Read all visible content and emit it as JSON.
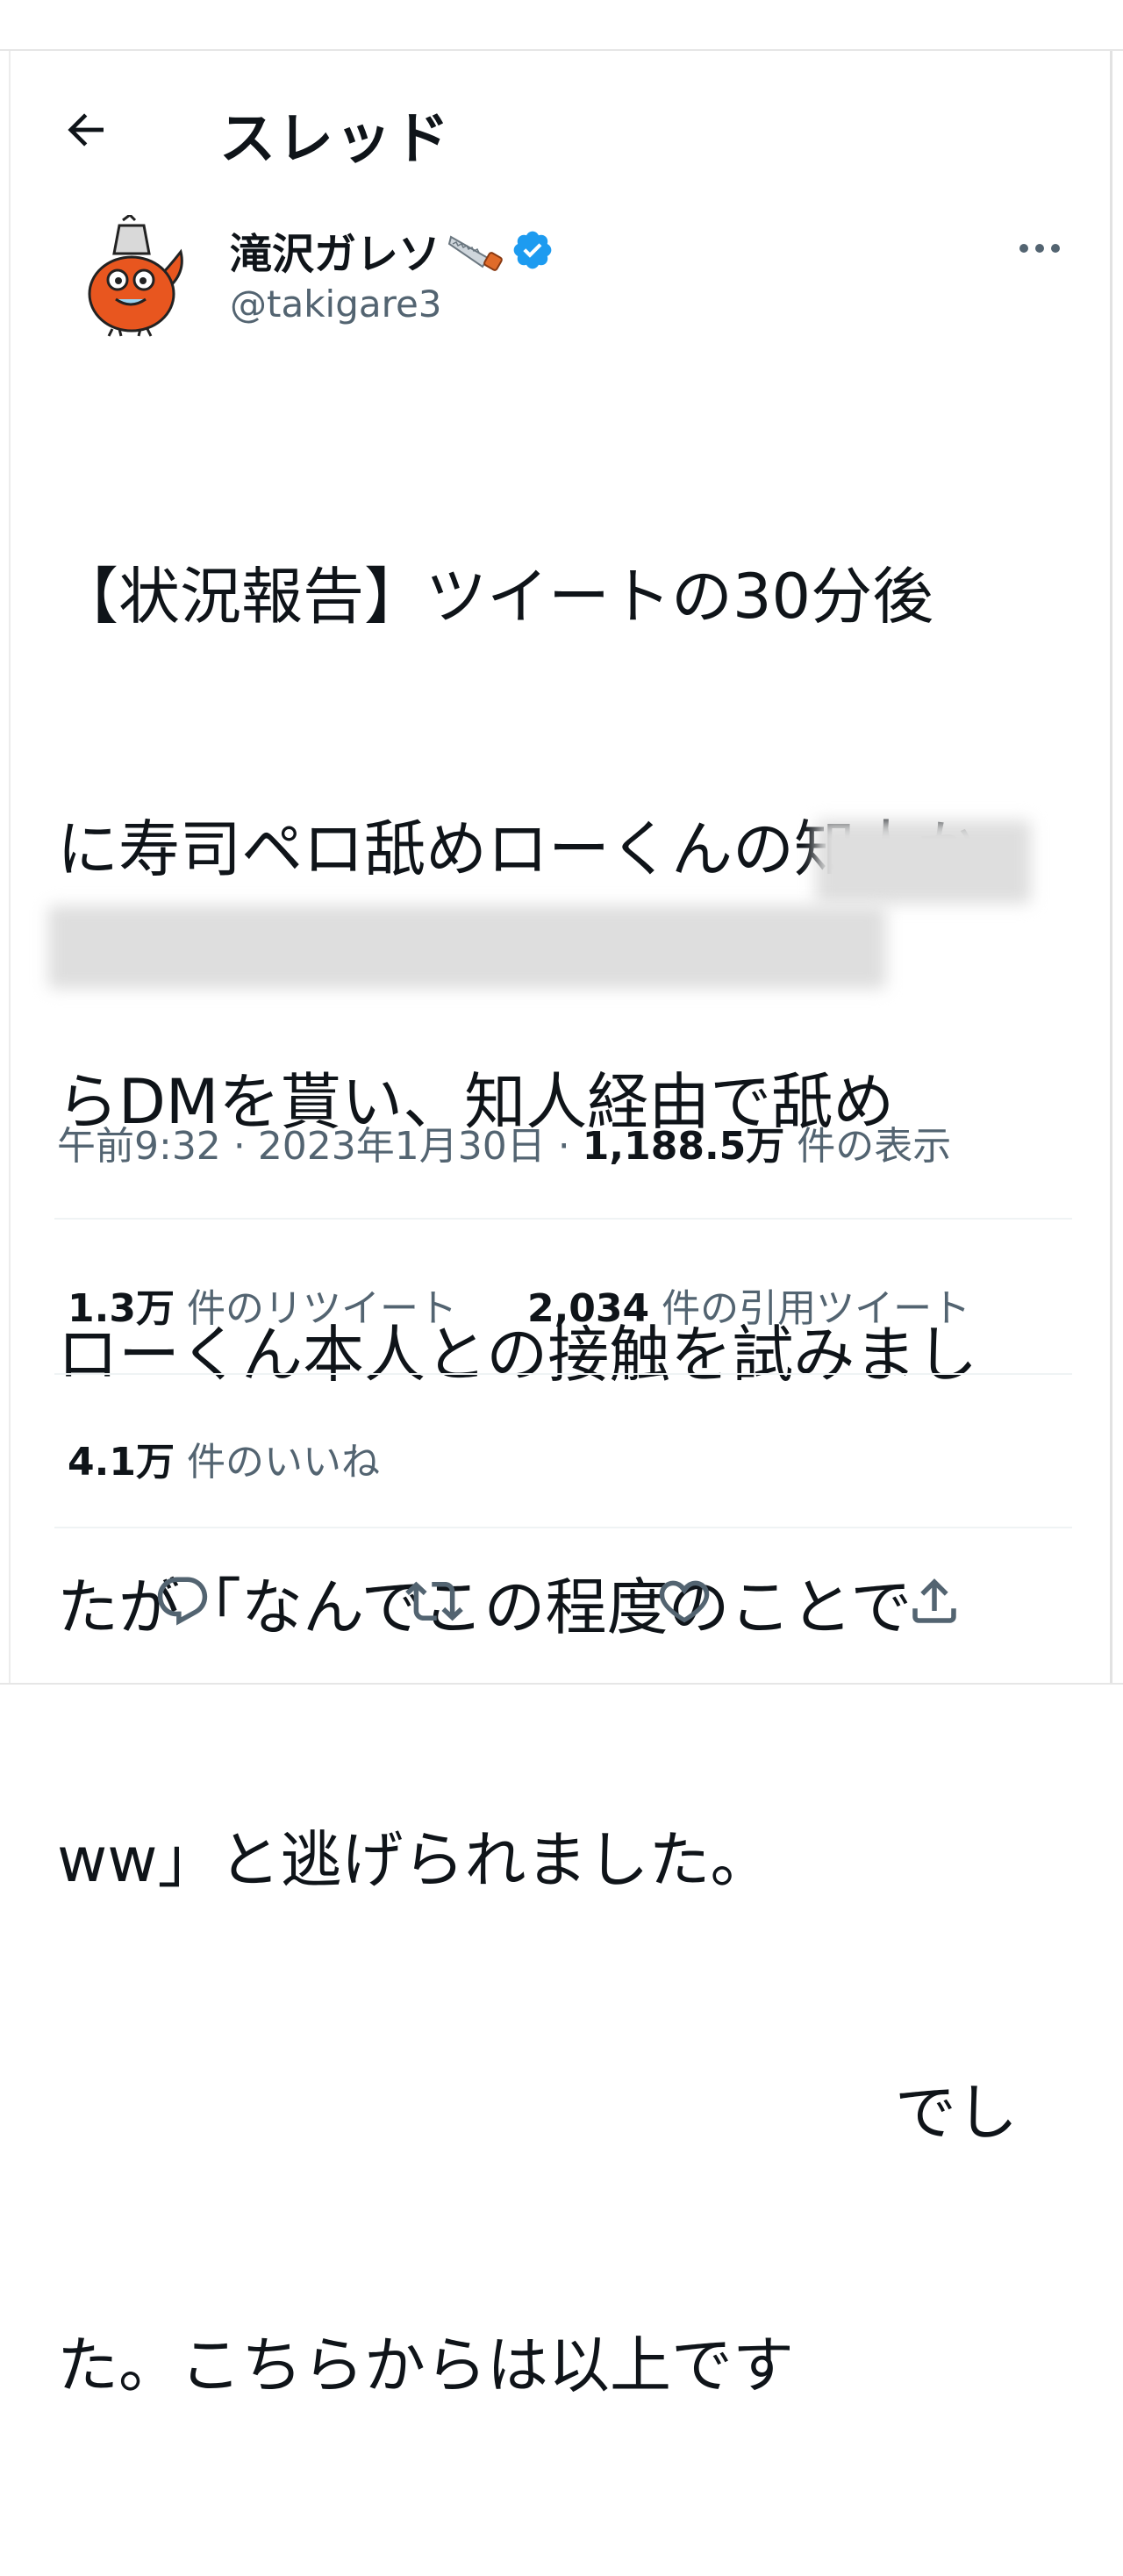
{
  "header": {
    "title": "スレッド",
    "back_icon": "arrow-left-icon"
  },
  "author": {
    "name": "滝沢ガレソ",
    "name_emoji": "saw-icon",
    "verified_icon": "verified-badge-icon",
    "handle": "@takigare3",
    "avatar": "orange-chainsaw-dog-avatar"
  },
  "tweet": {
    "lines": [
      "【状況報告】ツイートの30分後",
      "に寿司ペロ舐めローくんの知人か",
      "らDMを貰い、知人経由で舐め",
      "ローくん本人との接触を試みまし",
      "たが「なんでこの程度のことで",
      "ww」と逃げられました。",
      "でし",
      "た。こちらからは以上です"
    ]
  },
  "meta": {
    "time": "午前9:32",
    "separator": "·",
    "date": "2023年1月30日",
    "views_count": "1,188.5万",
    "views_label": "件の表示"
  },
  "stats": {
    "retweets_count": "1.3万",
    "retweets_label": "件のリツイート",
    "quotes_count": "2,034",
    "quotes_label": "件の引用ツイート",
    "likes_count": "4.1万",
    "likes_label": "件のいいね"
  },
  "actions": [
    "reply-icon",
    "retweet-icon",
    "like-icon",
    "share-icon"
  ],
  "colors": {
    "text": "#0f1419",
    "secondary": "#536471",
    "verified": "#1d9bf0",
    "avatar_orange": "#e8561f"
  }
}
